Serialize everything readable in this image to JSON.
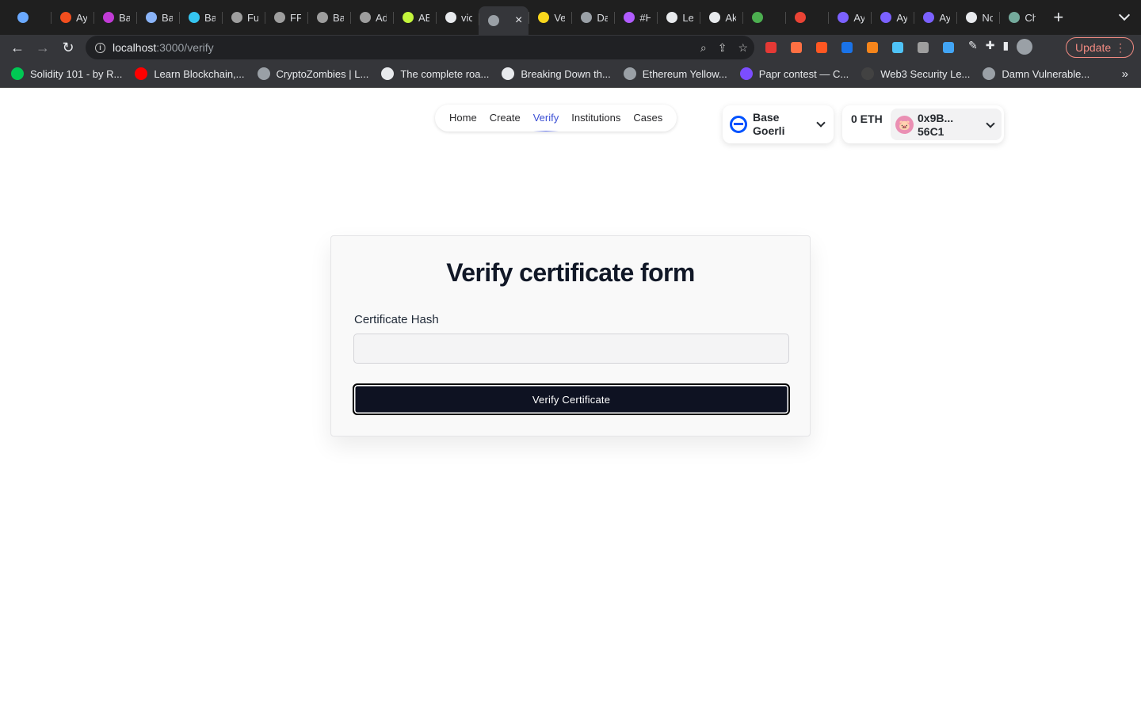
{
  "browser": {
    "tabs": [
      {
        "title": "",
        "color": "#6aa9ff"
      },
      {
        "title": "Aya",
        "color": "#f24e1e"
      },
      {
        "title": "Bas",
        "color": "#c13bd6"
      },
      {
        "title": "Bas",
        "color": "#8ab4f8"
      },
      {
        "title": "Bas",
        "color": "#35c5f0"
      },
      {
        "title": "Fur",
        "color": "#9e9e9e"
      },
      {
        "title": "FFF",
        "color": "#9e9e9e"
      },
      {
        "title": "Bas",
        "color": "#9e9e9e"
      },
      {
        "title": "Adv",
        "color": "#9e9e9e"
      },
      {
        "title": "ABI",
        "color": "#c3f53c"
      },
      {
        "title": "vic",
        "color": "#e8eaed"
      },
      {
        "title": "",
        "color": "#9aa0a6",
        "active": true
      },
      {
        "title": "Ver",
        "color": "#f9d71c"
      },
      {
        "title": "Dar",
        "color": "#9aa0a6"
      },
      {
        "title": "#Ha",
        "color": "#b15cff"
      },
      {
        "title": "Let",
        "color": "#e8eaed"
      },
      {
        "title": "Aki",
        "color": "#e8eaed"
      },
      {
        "title": "",
        "color": "#4caf50"
      },
      {
        "title": "",
        "color": "#ea4335"
      },
      {
        "title": "Aya",
        "color": "#7b61ff"
      },
      {
        "title": "Aya",
        "color": "#7b61ff"
      },
      {
        "title": "Aya",
        "color": "#7b61ff"
      },
      {
        "title": "No",
        "color": "#e8eaed"
      },
      {
        "title": "Ch",
        "color": "#74aa9c"
      }
    ],
    "close_glyph": "×",
    "new_tab_glyph": "+",
    "url_host": "localhost",
    "url_path": ":3000/verify",
    "update_label": "Update",
    "extensions": [
      {
        "name": "puzzle-red",
        "color": "#e53935"
      },
      {
        "name": "ext-orange",
        "color": "#ff7043"
      },
      {
        "name": "ext-brave",
        "color": "#ff5722"
      },
      {
        "name": "ext-coinbase",
        "color": "#1a73e8"
      },
      {
        "name": "ext-metamask",
        "color": "#f6851b"
      },
      {
        "name": "ext-blue-gem",
        "color": "#4fc3f7"
      },
      {
        "name": "ext-grey",
        "color": "#9e9e9e"
      },
      {
        "name": "ext-globe",
        "color": "#42a5f5"
      }
    ],
    "bookmarks": [
      {
        "label": "Solidity 101 - by R...",
        "color": "#00c853"
      },
      {
        "label": "Learn Blockchain,...",
        "color": "#ff0000"
      },
      {
        "label": "CryptoZombies | L...",
        "color": "#9aa0a6"
      },
      {
        "label": "The complete roa...",
        "color": "#e8eaed"
      },
      {
        "label": "Breaking Down th...",
        "color": "#e8eaed"
      },
      {
        "label": "Ethereum Yellow...",
        "color": "#9aa0a6"
      },
      {
        "label": "Papr contest — C...",
        "color": "#7c4dff"
      },
      {
        "label": "Web3 Security Le...",
        "color": "#424242"
      },
      {
        "label": "Damn Vulnerable...",
        "color": "#9aa0a6"
      }
    ],
    "bookmarks_more": "»"
  },
  "app": {
    "nav": [
      {
        "label": "Home",
        "active": false
      },
      {
        "label": "Create",
        "active": false
      },
      {
        "label": "Verify",
        "active": true
      },
      {
        "label": "Institutions",
        "active": false
      },
      {
        "label": "Cases",
        "active": false
      }
    ],
    "network": {
      "name": "Base Goerli",
      "color": "#0052ff"
    },
    "account": {
      "balance": "0 ETH",
      "address": "0x9B... 56C1",
      "avatar_emoji": "🐷",
      "avatar_color": "#ea8fb3"
    },
    "form": {
      "title": "Verify certificate form",
      "field_label": "Certificate Hash",
      "field_value": "",
      "submit_label": "Verify Certificate"
    }
  }
}
